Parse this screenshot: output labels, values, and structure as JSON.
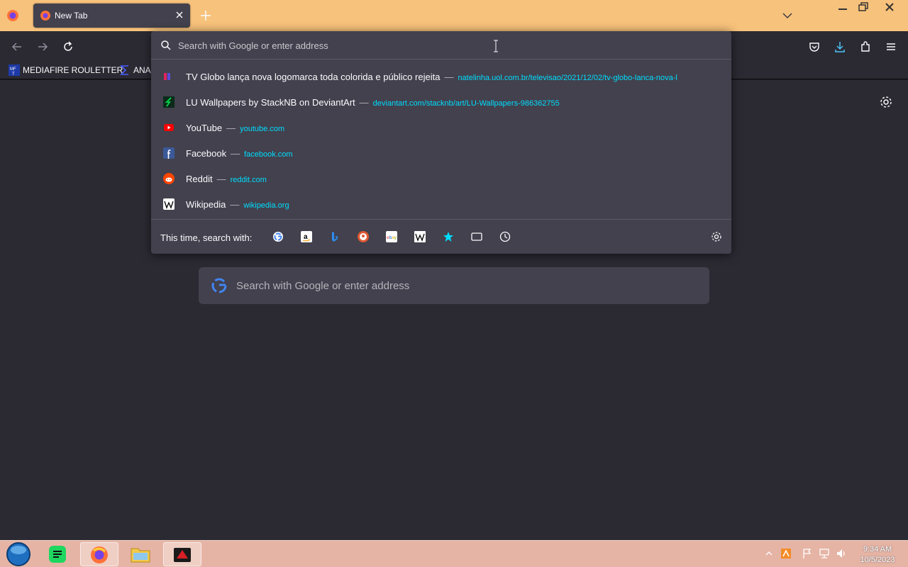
{
  "browser": {
    "tab": {
      "title": "New Tab"
    },
    "nav": {
      "back": "back-icon",
      "forward": "forward-icon",
      "reload": "reload-icon"
    },
    "toolbar_icons": [
      "pocket-icon",
      "downloads-icon",
      "extensions-icon",
      "menu-icon"
    ],
    "bookmarks": [
      {
        "label": "MEDIAFIRE ROULETTER",
        "icon": "mediafire-icon"
      },
      {
        "label": "ANA",
        "icon": "sigma-icon"
      }
    ]
  },
  "urlbar": {
    "placeholder": "Search with Google or enter address",
    "results": [
      {
        "title": "TV Globo lança nova logomarca toda colorida e público rejeita",
        "url": "natelinha.uol.com.br/televisao/2021/12/02/tv-globo-lanca-nova-l",
        "icon": "natelinha-icon"
      },
      {
        "title": "LU Wallpapers by StackNB on DeviantArt",
        "url": "deviantart.com/stacknb/art/LU-Wallpapers-986362755",
        "icon": "deviantart-icon"
      },
      {
        "title": "YouTube",
        "url": "youtube.com",
        "icon": "youtube-icon"
      },
      {
        "title": "Facebook",
        "url": "facebook.com",
        "icon": "facebook-icon"
      },
      {
        "title": "Reddit",
        "url": "reddit.com",
        "icon": "reddit-icon"
      },
      {
        "title": "Wikipedia",
        "url": "wikipedia.org",
        "icon": "wikipedia-icon"
      }
    ],
    "separator": "—",
    "one_off_label": "This time, search with:",
    "engines": [
      "google-icon",
      "amazon-icon",
      "bing-icon",
      "duckduckgo-icon",
      "ebay-icon",
      "wikipedia-icon",
      "bookmarks-star-icon",
      "tabs-icon",
      "history-icon"
    ]
  },
  "newtab": {
    "search_placeholder": "Search with Google or enter address"
  },
  "taskbar": {
    "apps": [
      "start-orb-icon",
      "notepad-icon",
      "firefox-icon",
      "file-explorer-icon",
      "media-app-icon"
    ],
    "clock": {
      "time": "9:34 AM",
      "date": "10/5/2023"
    }
  },
  "colors": {
    "titlebar": "#f7c27b",
    "toolbar": "#2b2a33",
    "popup": "#42414d",
    "url_accent": "#00ddff",
    "taskbar": "#e6b4a5"
  }
}
